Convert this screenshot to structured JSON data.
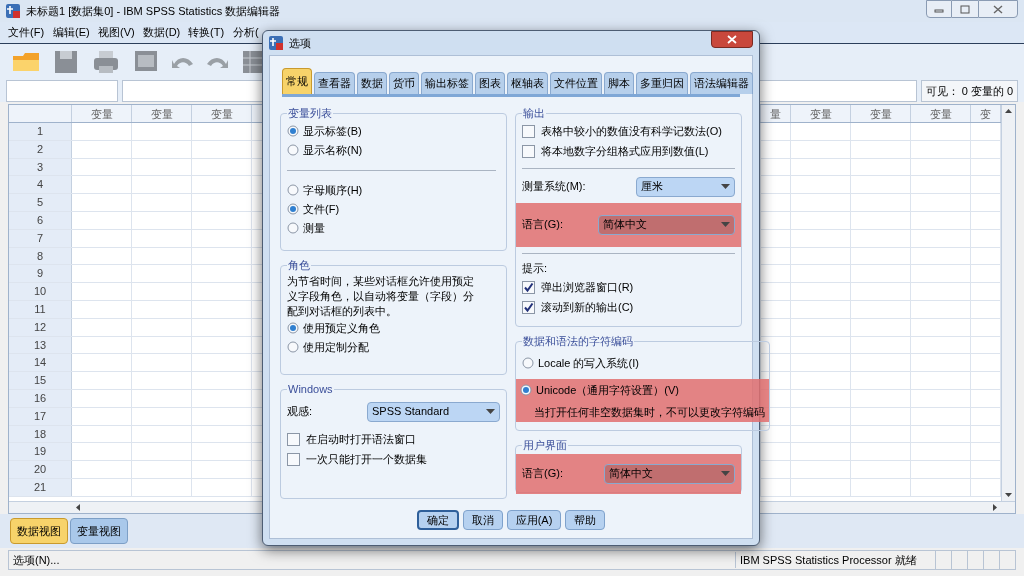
{
  "window": {
    "title": "未标题1 [数据集0] - IBM SPSS Statistics 数据编辑器"
  },
  "menu": [
    "文件(F)",
    "编辑(E)",
    "视图(V)",
    "数据(D)",
    "转换(T)",
    "分析("
  ],
  "cell_info": "可见： 0 变量的 0",
  "grid": {
    "columns_left": [
      "变量",
      "变量",
      "变量"
    ],
    "columns_right": [
      "量",
      "变量",
      "变量",
      "变量",
      "变"
    ],
    "rows": [
      "1",
      "2",
      "3",
      "4",
      "5",
      "6",
      "7",
      "8",
      "9",
      "10",
      "11",
      "12",
      "13",
      "14",
      "15",
      "16",
      "17",
      "18",
      "19",
      "20",
      "21"
    ]
  },
  "view_tabs": [
    {
      "label": "数据视图",
      "selected": true
    },
    {
      "label": "变量视图",
      "selected": false
    }
  ],
  "status_bar": {
    "left": "选项(N)...",
    "processor": "IBM SPSS Statistics Processor 就绪"
  },
  "dialog": {
    "title": "选项",
    "tabs": [
      {
        "label": "常规",
        "selected": true
      },
      {
        "label": "查看器",
        "selected": false
      },
      {
        "label": "数据",
        "selected": false
      },
      {
        "label": "货币",
        "selected": false
      },
      {
        "label": "输出标签",
        "selected": false
      },
      {
        "label": "图表",
        "selected": false
      },
      {
        "label": "枢轴表",
        "selected": false
      },
      {
        "label": "文件位置",
        "selected": false
      },
      {
        "label": "脚本",
        "selected": false
      },
      {
        "label": "多重归因",
        "selected": false
      },
      {
        "label": "语法编辑器",
        "selected": false
      }
    ],
    "variable_list": {
      "title": "变量列表",
      "display": [
        {
          "label": "显示标签(B)",
          "selected": true
        },
        {
          "label": "显示名称(N)",
          "selected": false
        }
      ],
      "order": [
        {
          "label": "字母顺序(H)",
          "selected": false
        },
        {
          "label": "文件(F)",
          "selected": true
        },
        {
          "label": "测量",
          "selected": false
        }
      ]
    },
    "roles": {
      "title": "角色",
      "description": "为节省时间，某些对话框允许使用预定义字段角色，以自动将变量（字段）分配到对话框的列表中。",
      "options": [
        {
          "label": "使用预定义角色",
          "selected": true
        },
        {
          "label": "使用定制分配",
          "selected": false
        }
      ]
    },
    "windows": {
      "title": "Windows",
      "look_label": "观感:",
      "look_value": "SPSS Standard",
      "checkboxes": [
        {
          "label": "在启动时打开语法窗口",
          "checked": false
        },
        {
          "label": "一次只能打开一个数据集",
          "checked": false
        }
      ]
    },
    "output": {
      "title": "输出",
      "checkboxes": [
        {
          "label": "表格中较小的数值没有科学记数法(O)",
          "checked": false
        },
        {
          "label": "将本地数字分组格式应用到数值(L)",
          "checked": false
        }
      ],
      "measurement_label": "测量系统(M):",
      "measurement_value": "厘米",
      "language_label": "语言(G):",
      "language_value": "简体中文",
      "language_highlighted": true,
      "notify_title": "提示:",
      "notify": [
        {
          "label": "弹出浏览器窗口(R)",
          "checked": true
        },
        {
          "label": "滚动到新的输出(C)",
          "checked": true
        }
      ]
    },
    "encoding": {
      "title": "数据和语法的字符编码",
      "options": [
        {
          "label": "Locale 的写入系统(I)",
          "selected": false
        },
        {
          "label": "Unicode（通用字符设置）(V)",
          "selected": true
        }
      ],
      "note": "当打开任何非空数据集时，不可以更改字符编码",
      "highlighted": true
    },
    "ui": {
      "title": "用户界面",
      "language_label": "语言(G):",
      "language_value": "简体中文",
      "highlighted": true
    },
    "buttons": [
      {
        "label": "确定",
        "default": true
      },
      {
        "label": "取消",
        "default": false
      },
      {
        "label": "应用(A)",
        "default": false
      },
      {
        "label": "帮助",
        "default": false
      }
    ]
  }
}
